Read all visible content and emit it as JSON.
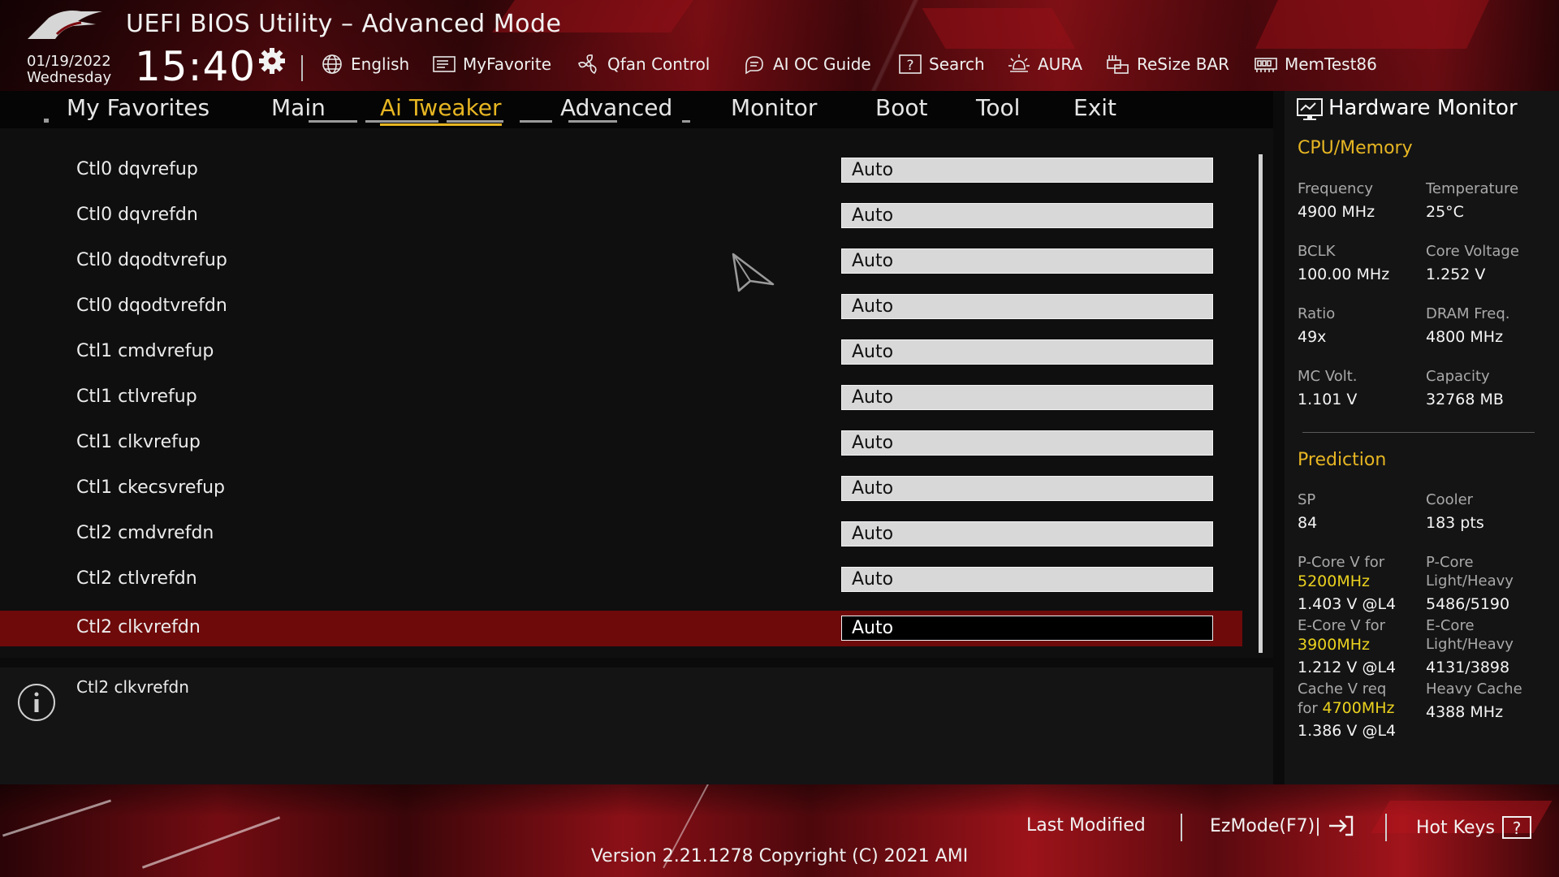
{
  "header": {
    "title": "UEFI BIOS Utility – Advanced Mode",
    "date": "01/19/2022",
    "weekday": "Wednesday",
    "time": "15:40",
    "tools": [
      {
        "label": "English",
        "icon": "globe-icon"
      },
      {
        "label": "MyFavorite",
        "icon": "favorite-list-icon"
      },
      {
        "label": "Qfan Control",
        "icon": "fan-icon"
      },
      {
        "label": "AI OC Guide",
        "icon": "ai-oc-guide-icon"
      },
      {
        "label": "Search",
        "icon": "search-help-icon"
      },
      {
        "label": "AURA",
        "icon": "aura-light-icon"
      },
      {
        "label": "ReSize BAR",
        "icon": "resize-bar-icon"
      },
      {
        "label": "MemTest86",
        "icon": "memory-icon"
      }
    ]
  },
  "nav": {
    "tabs": [
      {
        "label": "My Favorites"
      },
      {
        "label": "Main"
      },
      {
        "label": "Ai Tweaker",
        "active": true
      },
      {
        "label": "Advanced"
      },
      {
        "label": "Monitor"
      },
      {
        "label": "Boot"
      },
      {
        "label": "Tool"
      },
      {
        "label": "Exit"
      }
    ]
  },
  "settings": {
    "rows": [
      {
        "label": "Ctl0 dqvrefup",
        "value": "Auto"
      },
      {
        "label": "Ctl0 dqvrefdn",
        "value": "Auto"
      },
      {
        "label": "Ctl0 dqodtvrefup",
        "value": "Auto"
      },
      {
        "label": "Ctl0 dqodtvrefdn",
        "value": "Auto"
      },
      {
        "label": "Ctl1 cmdvrefup",
        "value": "Auto"
      },
      {
        "label": "Ctl1 ctlvrefup",
        "value": "Auto"
      },
      {
        "label": "Ctl1 clkvrefup",
        "value": "Auto"
      },
      {
        "label": "Ctl1 ckecsvrefup",
        "value": "Auto"
      },
      {
        "label": "Ctl2 cmdvrefdn",
        "value": "Auto"
      },
      {
        "label": "Ctl2 ctlvrefdn",
        "value": "Auto"
      },
      {
        "label": "Ctl2 clkvrefdn",
        "value": "Auto",
        "selected": true
      }
    ]
  },
  "help": {
    "text": "Ctl2 clkvrefdn"
  },
  "hardware_monitor": {
    "title": "Hardware Monitor",
    "cpu_memory": {
      "heading": "CPU/Memory",
      "frequency_label": "Frequency",
      "frequency_value": "4900 MHz",
      "temperature_label": "Temperature",
      "temperature_value": "25°C",
      "bclk_label": "BCLK",
      "bclk_value": "100.00 MHz",
      "core_voltage_label": "Core Voltage",
      "core_voltage_value": "1.252 V",
      "ratio_label": "Ratio",
      "ratio_value": "49x",
      "dram_freq_label": "DRAM Freq.",
      "dram_freq_value": "4800 MHz",
      "mc_volt_label": "MC Volt.",
      "mc_volt_value": "1.101 V",
      "capacity_label": "Capacity",
      "capacity_value": "32768 MB"
    },
    "prediction": {
      "heading": "Prediction",
      "sp_label": "SP",
      "sp_value": "84",
      "cooler_label": "Cooler",
      "cooler_value": "183 pts",
      "pcore_v_label": "P-Core V for",
      "pcore_v_freq": "5200MHz",
      "pcore_v_value": "1.403 V @L4",
      "pcore_lh_label1": "P-Core",
      "pcore_lh_label2": "Light/Heavy",
      "pcore_lh_value": "5486/5190",
      "ecore_v_label": "E-Core V for",
      "ecore_v_freq": "3900MHz",
      "ecore_v_value": "1.212 V @L4",
      "ecore_lh_label1": "E-Core",
      "ecore_lh_label2": "Light/Heavy",
      "ecore_lh_value": "4131/3898",
      "cache_v_label1": "Cache V req",
      "cache_v_label2": "for",
      "cache_v_freq": "4700MHz",
      "cache_v_value": "1.386 V @L4",
      "heavy_cache_label": "Heavy Cache",
      "heavy_cache_value": "4388 MHz"
    }
  },
  "footer": {
    "last_modified": "Last Modified",
    "ezmode": "EzMode(F7)|",
    "hotkeys": "Hot Keys",
    "version": "Version 2.21.1278 Copyright (C) 2021 AMI"
  },
  "colors": {
    "accent_gold": "#e7b622",
    "highlight_yellow": "#ebd21e",
    "selection_red": "#6e0a0a",
    "brand_red": "#9c131a"
  }
}
